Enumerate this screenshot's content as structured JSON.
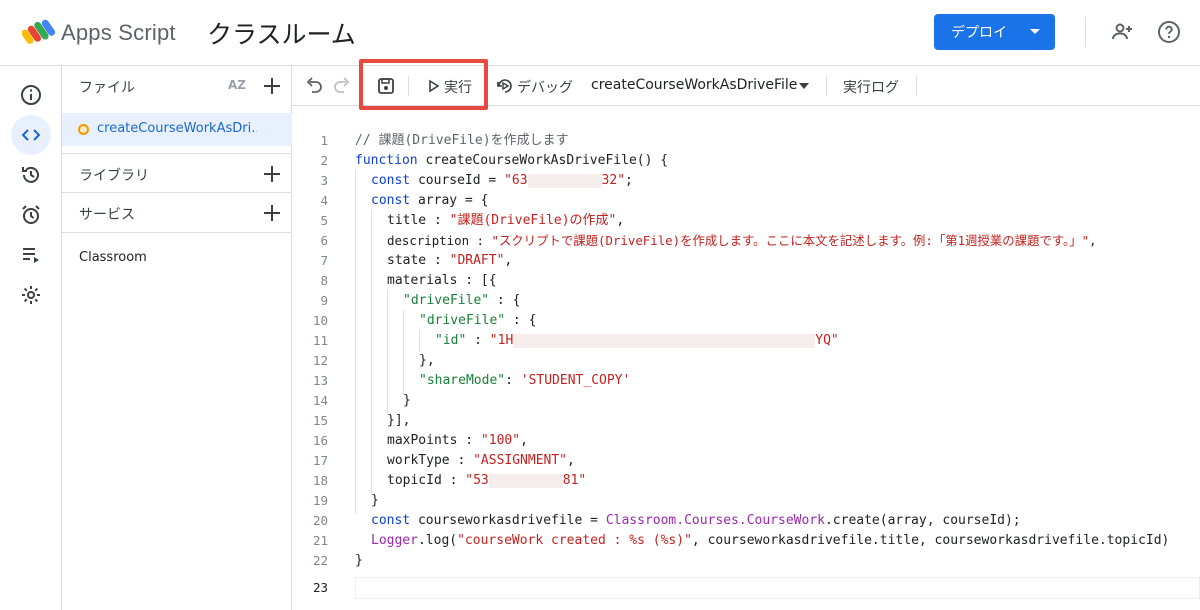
{
  "header": {
    "app_name": "Apps Script",
    "project_title": "クラスルーム",
    "deploy_label": "デプロイ",
    "icons": [
      "add-person-icon",
      "help-icon"
    ]
  },
  "rail": {
    "icons": [
      "info-icon",
      "code-icon",
      "history-icon",
      "alarm-icon",
      "executions-icon",
      "settings-icon"
    ],
    "active": "code-icon"
  },
  "files": {
    "header_label": "ファイル",
    "sort_label": "AZ",
    "file_name": "createCourseWorkAsDri...",
    "libraries_label": "ライブラリ",
    "services_label": "サービス",
    "services": [
      "Classroom"
    ]
  },
  "toolbar": {
    "run_label": "実行",
    "debug_label": "デバッグ",
    "function_name": "createCourseWorkAsDriveFile",
    "log_label": "実行ログ"
  },
  "editor": {
    "line_numbers": [
      "1",
      "2",
      "3",
      "4",
      "5",
      "6",
      "7",
      "8",
      "9",
      "10",
      "11",
      "12",
      "13",
      "14",
      "15",
      "16",
      "17",
      "18",
      "19",
      "20",
      "21",
      "22",
      "23"
    ],
    "tokens": {
      "l1": "// 課題(DriveFile)を作成します",
      "l2_kw": "function",
      "l2_rest": " createCourseWorkAsDriveFile() {",
      "l3_kw": "const",
      "l3_rest": " courseId = ",
      "l3_str1": "\"63",
      "l3_str2": "32\"",
      "l3_end": ";",
      "l4_kw": "const",
      "l4_rest": " array = {",
      "l5_a": "title : ",
      "l5_str": "\"課題(DriveFile)の作成\"",
      "l5_end": ",",
      "l6_a": "description : ",
      "l6_str": "\"スクリプトで課題(DriveFile)を作成します。ここに本文を記述します。例:「第1週授業の課題です。」\"",
      "l6_end": ",",
      "l7_a": "state : ",
      "l7_str": "\"DRAFT\"",
      "l7_end": ",",
      "l8": "materials : [{",
      "l9_str": "\"driveFile\"",
      "l9_rest": " : {",
      "l10_str": "\"driveFile\"",
      "l10_rest": " : {",
      "l11_str": "\"id\"",
      "l11_mid": " : ",
      "l11_val1": "\"1H",
      "l11_val2": "YQ\"",
      "l12": "},",
      "l13_str": "\"shareMode\"",
      "l13_mid": ": ",
      "l13_val": "'STUDENT_COPY'",
      "l14": "}",
      "l15": "}],",
      "l16_a": "maxPoints : ",
      "l16_str": "\"100\"",
      "l16_end": ",",
      "l17_a": "workType : ",
      "l17_str": "\"ASSIGNMENT\"",
      "l17_end": ",",
      "l18_a": "topicId : ",
      "l18_str1": "\"53",
      "l18_str2": "81\"",
      "l19": "}",
      "l20_kw": "const",
      "l20_a": " courseworkasdrivefile = ",
      "l20_cls": "Classroom.Courses.CourseWork",
      "l20_rest": ".create(array, courseId);",
      "l21_cls": "Logger",
      "l21_a": ".log(",
      "l21_str": "\"courseWork created : %s (%s)\"",
      "l21_rest": ", courseworkasdrivefile.title, courseworkasdrivefile.topicId)",
      "l22": "}"
    }
  },
  "colors": {
    "accent": "#1a73e8",
    "highlight_box": "#e84a3f",
    "keyword": "#0b3fd9",
    "string": "#c5221f",
    "class": "#9c27b0"
  }
}
